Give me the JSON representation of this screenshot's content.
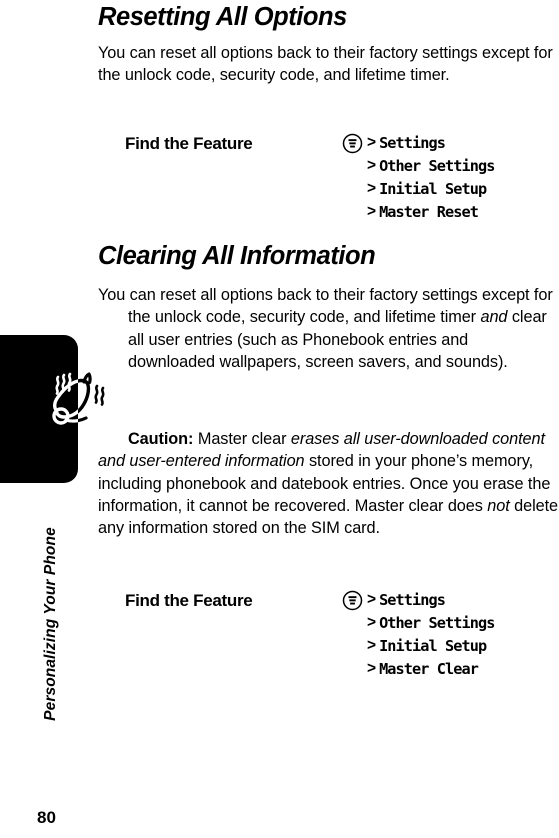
{
  "page": {
    "folio": "80",
    "chapter_label": "Personalizing Your Phone",
    "chapter_icon": "bell-icon"
  },
  "sections": [
    {
      "heading": "Resetting All Options",
      "paragraph_plain": "You can reset all options back to their factory settings except for the unlock code, security code, and lifetime timer.",
      "paragraph_lead": "You can reset all options back to their factory settings except for the unlock code, security code, and lifetime timer."
    },
    {
      "heading": "Clearing All Information",
      "paragraph_lead": "You can reset all options back to their factory settings except for the unlock code, security code, and lifetime timer ",
      "paragraph_italic": "and",
      "paragraph_tail": " clear all user entries (such as Phonebook entries and downloaded wallpapers, screen savers, and sounds).",
      "caution_label": "Caution:",
      "caution_part1": " Master clear ",
      "caution_italic1": "erases all user-downloaded content and user-entered information",
      "caution_part2": " stored in your phone’s memory, including phonebook and datebook entries. Once you erase the information, it cannot be recovered. Master clear does ",
      "caution_italic2": "not",
      "caution_part3": " delete any information stored on the SIM card."
    }
  ],
  "find_the_feature": [
    {
      "label": "Find the Feature",
      "menu_icon": "menu-key-icon",
      "separator": ">",
      "items": [
        "Settings",
        "Other Settings",
        "Initial Setup",
        "Master Reset"
      ]
    },
    {
      "label": "Find the Feature",
      "menu_icon": "menu-key-icon",
      "separator": ">",
      "items": [
        "Settings",
        "Other Settings",
        "Initial Setup",
        "Master Clear"
      ]
    }
  ],
  "colors": {
    "ink": "#000000",
    "paper": "#ffffff"
  }
}
